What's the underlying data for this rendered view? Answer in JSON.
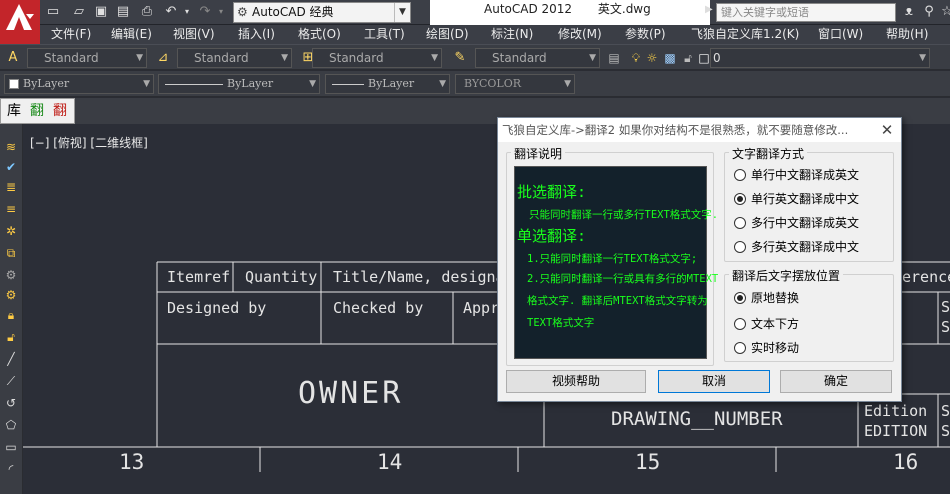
{
  "titlebar": {
    "workspace": "AutoCAD 经典",
    "app_name": "AutoCAD 2012",
    "file_name": "英文.dwg",
    "search_placeholder": "键入关键字或短语"
  },
  "menu": {
    "items": [
      "文件(F)",
      "编辑(E)",
      "视图(V)",
      "插入(I)",
      "格式(O)",
      "工具(T)",
      "绘图(D)",
      "标注(N)",
      "修改(M)",
      "参数(P)",
      "飞狼自定义库1.2(K)",
      "窗口(W)",
      "帮助(H)"
    ]
  },
  "styles_toolbar": {
    "text_style": "Standard",
    "dim_style": "Standard",
    "table_style": "Standard",
    "mleader_style": "Standard",
    "layer_value": "0"
  },
  "props_toolbar": {
    "color": "ByLayer",
    "linetype": "ByLayer",
    "lineweight": "ByLayer",
    "plotstyle": "BYCOLOR"
  },
  "plugin_toolbar": {
    "lib_label": "库",
    "translate1_label": "翻",
    "translate2_label": "翻"
  },
  "canvas": {
    "viewport_label": "[−] [俯视] [二维线框]",
    "title_block": {
      "itemref": "Itemref",
      "quantity": "Quantity",
      "title": "Title/Name, designati",
      "reference": "erence",
      "designed_by": "Designed by",
      "checked_by": "Checked by",
      "approved": "Appr",
      "s_letter_1": "S",
      "s_letter_2": "S",
      "owner": "OWNER",
      "drawing_number": "DRAWING__NUMBER",
      "edition_label": "Edition",
      "edition_value": "EDITION",
      "s_letter_3": "S",
      "s_letter_4": "S"
    },
    "ruler_numbers": [
      "13",
      "14",
      "15",
      "16"
    ]
  },
  "dialog": {
    "title": "飞狼自定义库->翻译2  如果你对结构不是很熟悉，就不要随意修改...",
    "desc_group_title": "翻译说明",
    "desc_lines": {
      "l1": "批选翻译:",
      "l2": "只能同时翻译一行或多行TEXT格式文字.",
      "l3": "单选翻译:",
      "l4": "1.只能同时翻译一行TEXT格式文字;",
      "l5": "2.只能同时翻译一行或具有多行的MTEXT",
      "l6": "格式文字. 翻译后MTEXT格式文字转为",
      "l7": "TEXT格式文字"
    },
    "mode_group_title": "文字翻译方式",
    "mode_options": [
      "单行中文翻译成英文",
      "单行英文翻译成中文",
      "多行中文翻译成英文",
      "多行英文翻译成中文"
    ],
    "mode_selected": 1,
    "position_group_title": "翻译后文字摆放位置",
    "position_options": [
      "原地替换",
      "文本下方",
      "实时移动"
    ],
    "position_selected": 0,
    "buttons": {
      "help": "视频帮助",
      "cancel": "取消",
      "ok": "确定"
    }
  },
  "colors": {
    "canvas_bg": "#2b2e37",
    "desc_text": "#19ff1c",
    "logo_red": "#c3252a"
  }
}
